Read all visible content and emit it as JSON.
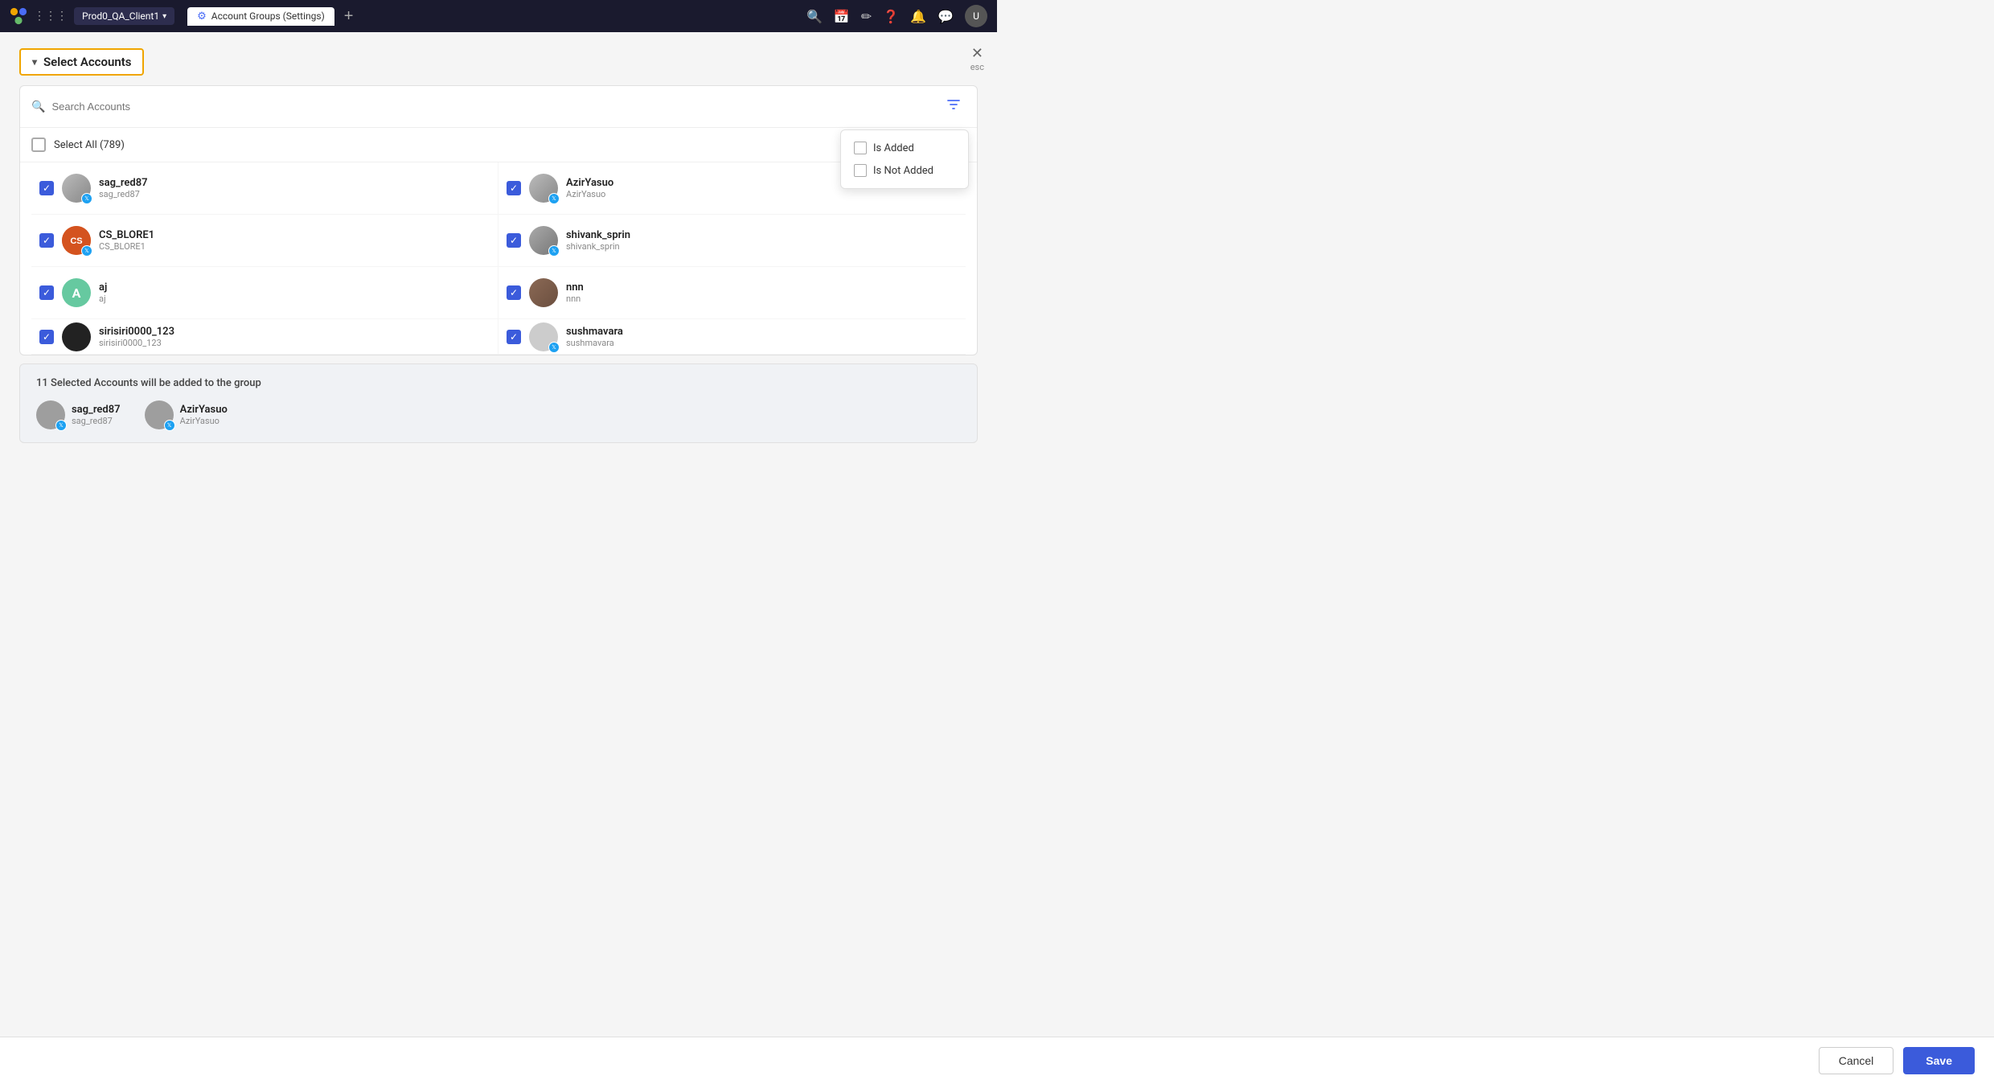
{
  "topnav": {
    "client_label": "Prod0_QA_Client1",
    "tab_label": "Account Groups (Settings)",
    "add_tab_label": "+",
    "icons": [
      "search",
      "calendar",
      "edit",
      "help",
      "chat",
      "bell"
    ],
    "chevron_down": "▾"
  },
  "header": {
    "title": "Select Accounts",
    "arrow": "▾",
    "esc_label": "esc",
    "close_icon": "✕"
  },
  "search": {
    "placeholder": "Search Accounts",
    "filter_icon": "⊿"
  },
  "filter_dropdown": {
    "option1": "Is Added",
    "option2": "Is Not Added"
  },
  "select_all": {
    "label": "Select All (789)"
  },
  "accounts": [
    {
      "id": 1,
      "name": "sag_red87",
      "handle": "sag_red87",
      "checked": true,
      "avatar_class": "av-img-sag",
      "has_twitter": true,
      "initials": ""
    },
    {
      "id": 2,
      "name": "AzirYasuo",
      "handle": "AzirYasuo",
      "checked": true,
      "avatar_class": "av-img-azir",
      "has_twitter": true,
      "initials": ""
    },
    {
      "id": 3,
      "name": "CS_BLORE1",
      "handle": "CS_BLORE1",
      "checked": true,
      "avatar_class": "av-img-cs",
      "has_twitter": true,
      "initials": ""
    },
    {
      "id": 4,
      "name": "shivank_sprin",
      "handle": "shivank_sprin",
      "checked": true,
      "avatar_class": "av-img-shiv",
      "has_twitter": true,
      "initials": ""
    },
    {
      "id": 5,
      "name": "aj",
      "handle": "aj",
      "checked": true,
      "avatar_class": "av-img-aj",
      "has_twitter": false,
      "initials": "A"
    },
    {
      "id": 6,
      "name": "nnn",
      "handle": "nnn",
      "checked": true,
      "avatar_class": "av-img-nnn",
      "has_twitter": false,
      "initials": ""
    },
    {
      "id": 7,
      "name": "sirisiri0000_123",
      "handle": "sirisiri0000_123",
      "checked": true,
      "avatar_class": "av-img-siri",
      "has_twitter": false,
      "initials": ""
    },
    {
      "id": 8,
      "name": "sushmavara",
      "handle": "sushmavara",
      "checked": true,
      "avatar_class": "av-img-sush",
      "has_twitter": true,
      "initials": ""
    }
  ],
  "selected_panel": {
    "info_text": "11 Selected Accounts will be added to the group",
    "accounts": [
      {
        "name": "sag_red87",
        "handle": "sag_red87",
        "has_twitter": true
      },
      {
        "name": "AzirYasuo",
        "handle": "AzirYasuo",
        "has_twitter": true
      }
    ]
  },
  "footer": {
    "cancel_label": "Cancel",
    "save_label": "Save"
  }
}
